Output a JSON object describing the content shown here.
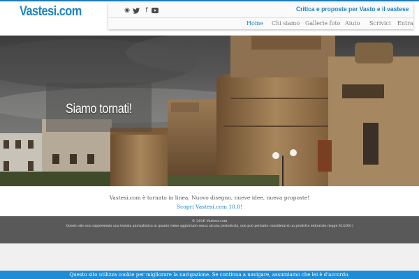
{
  "site": {
    "logo": "Vastesi.com",
    "tagline": "Critica e proposte per Vasto e il vastese"
  },
  "social": [
    {
      "icon": "rss-icon",
      "glyph": "◉"
    },
    {
      "icon": "twitter-icon",
      "glyph": "🐦"
    },
    {
      "icon": "facebook-icon",
      "glyph": "f"
    },
    {
      "icon": "youtube-icon",
      "glyph": "▶"
    }
  ],
  "nav": {
    "items": [
      {
        "label": "Home",
        "active": true
      },
      {
        "label": "Chi siamo",
        "active": false
      },
      {
        "label": "Gallerie foto",
        "active": false
      },
      {
        "label": "Aiuto",
        "active": false
      },
      {
        "label": "Scrivici",
        "active": false
      },
      {
        "label": "Entra",
        "active": false
      }
    ]
  },
  "hero": {
    "title": "Siamo tornati!"
  },
  "content": {
    "intro": "Vastesi.com è tornato in linea. Nuovo disegno, nueve idee, nueva proposte!",
    "link": "Scopri Vastesi.com 10.0!"
  },
  "footer": {
    "copyright": "© 2016 Vastesi.com",
    "legal": "Questo sito non rappresenta una testata giornalistica in quanto viene aggiornato senza alcuna periodicità, non può pertanto considerarsi un prodotto editoriale (legge 62/2001)"
  },
  "cookie": {
    "text": "Questo sito utilizza cookie per migliorare la navigazione. Se continua a navigare, assumiamo che lei è d'accordo."
  },
  "colors": {
    "brand": "#1b83c5",
    "footer": "#595959",
    "cookie": "#1f8dd6"
  }
}
